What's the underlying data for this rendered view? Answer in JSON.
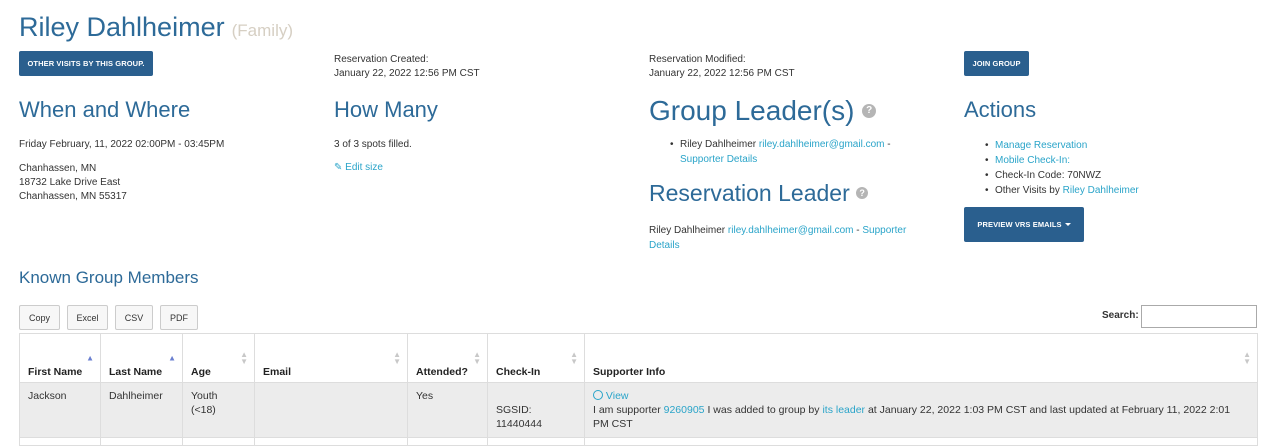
{
  "header": {
    "name": "Riley Dahlheimer",
    "type": "(Family)"
  },
  "buttons": {
    "other_visits": "OTHER VISITS BY THIS GROUP.",
    "join_group": "JOIN GROUP",
    "preview_emails": "PREVIEW VRS EMAILS"
  },
  "reservation": {
    "created_label": "Reservation Created:",
    "created_value": "January 22, 2022 12:56 PM CST",
    "modified_label": "Reservation Modified:",
    "modified_value": "January 22, 2022 12:56 PM CST"
  },
  "when_where": {
    "title": "When and Where",
    "datetime": "Friday February, 11, 2022 02:00PM - 03:45PM",
    "location": "Chanhassen, MN",
    "address1": "18732 Lake Drive East",
    "address2": "Chanhassen, MN 55317"
  },
  "how_many": {
    "title": "How Many",
    "spots": "3 of 3 spots filled.",
    "edit_label": "Edit size"
  },
  "group_leaders": {
    "title": "Group Leader(s)",
    "leader_name": "Riley Dahlheimer",
    "leader_email": "riley.dahlheimer@gmail.com",
    "separator": "-",
    "supporter_details": "Supporter Details"
  },
  "reservation_leader": {
    "title": "Reservation Leader",
    "name": "Riley Dahlheimer",
    "email": "riley.dahlheimer@gmail.com",
    "separator": "-",
    "supporter_link_1": "Supporter",
    "supporter_link_2": "Details"
  },
  "actions": {
    "title": "Actions",
    "manage": "Manage Reservation",
    "mobile_checkin": "Mobile Check-In:",
    "checkin_code": "Check-In Code: 70NWZ",
    "other_visits_prefix": "Other Visits by",
    "other_visits_name": "Riley Dahlheimer"
  },
  "members": {
    "title": "Known Group Members",
    "export_buttons": [
      "Copy",
      "Excel",
      "CSV",
      "PDF"
    ],
    "search_label": "Search:",
    "search_value": "",
    "columns": [
      "First Name",
      "Last Name",
      "Age",
      "Email",
      "Attended?",
      "Check-In",
      "Supporter Info"
    ],
    "rows": [
      {
        "first": "Jackson",
        "last": "Dahlheimer",
        "age_line1": "Youth",
        "age_line2": "(<18)",
        "email": "",
        "attended": "Yes",
        "checkin_line1": "SGSID:",
        "checkin_line2": "11440444",
        "view_label": "View",
        "info_prefix": "I am supporter",
        "supporter_id": "9260905",
        "info_mid": "I was added to group by",
        "its_leader": "its leader",
        "info_suffix": "at January 22, 2022 1:03 PM CST and last updated at February 11, 2022 2:01",
        "info_line2": "PM CST"
      }
    ]
  }
}
